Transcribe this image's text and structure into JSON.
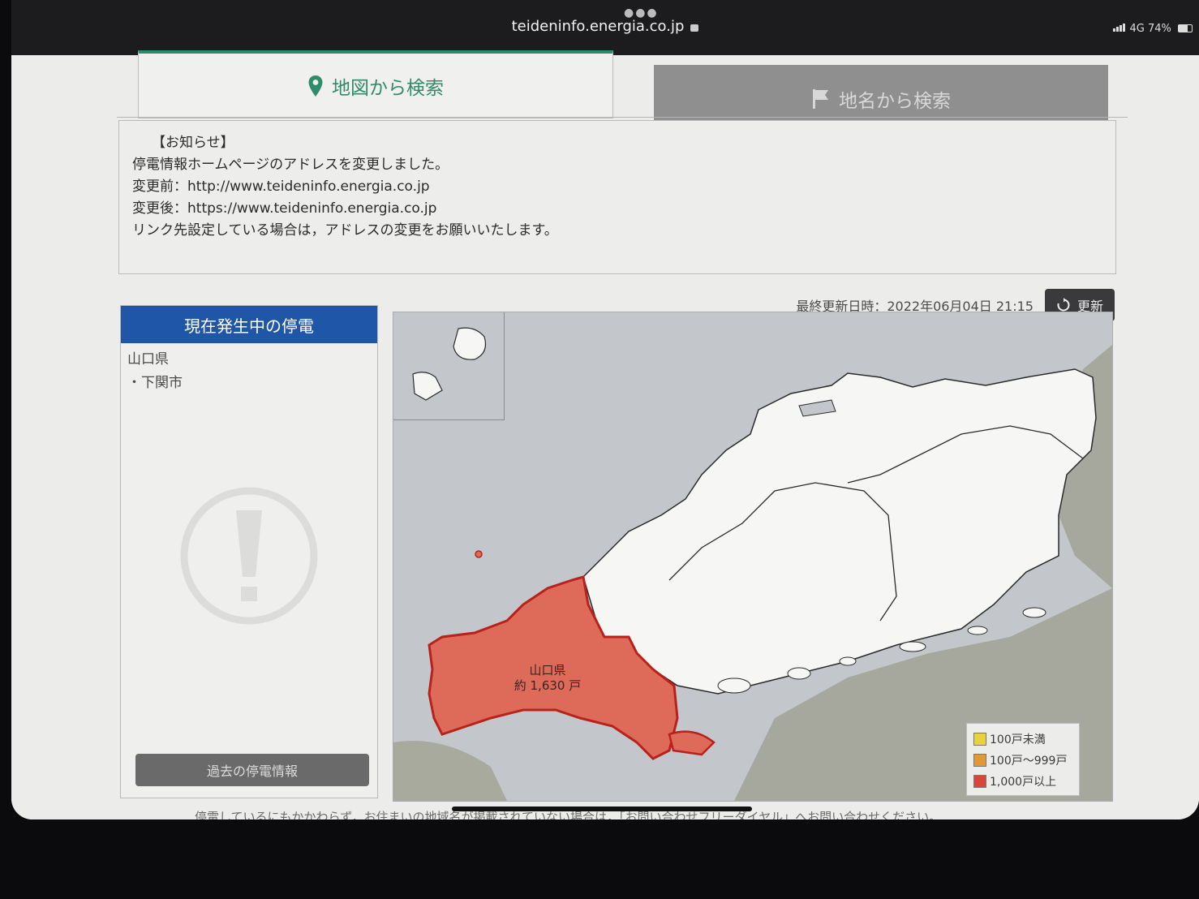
{
  "browser": {
    "url": "teideninfo.energia.co.jp",
    "network": "4G",
    "battery": "74%"
  },
  "tabs": [
    {
      "label": "地図から検索",
      "icon": "map-pin-icon"
    },
    {
      "label": "地名から検索",
      "icon": "flag-icon"
    }
  ],
  "notice": {
    "title": "【お知らせ】",
    "lines": [
      "停電情報ホームページのアドレスを変更しました。",
      "変更前：http://www.teideninfo.energia.co.jp",
      "変更後：https://www.teideninfo.energia.co.jp",
      "リンク先設定している場合は，アドレスの変更をお願いいたします。"
    ]
  },
  "update": {
    "label": "最終更新日時：2022年06月04日 21:15",
    "button": "更新"
  },
  "outage_panel": {
    "title": "現在発生中の停電",
    "prefecture": "山口県",
    "city": "・下関市",
    "past_button": "過去の停電情報"
  },
  "map": {
    "region_label": "山口県",
    "count_label": "約 1,630 戸",
    "legend": [
      {
        "label": "100戸未満",
        "color": "#e8d43a"
      },
      {
        "label": "100戸〜999戸",
        "color": "#e0983a"
      },
      {
        "label": "1,000戸以上",
        "color": "#d9473b"
      }
    ],
    "highlight_color": "#de6a5a"
  },
  "footer_note": "停電しているにもかかわらず，お住まいの地域名が掲載されていない場合は，「お問い合わせフリーダイヤル」へお問い合わせください。"
}
